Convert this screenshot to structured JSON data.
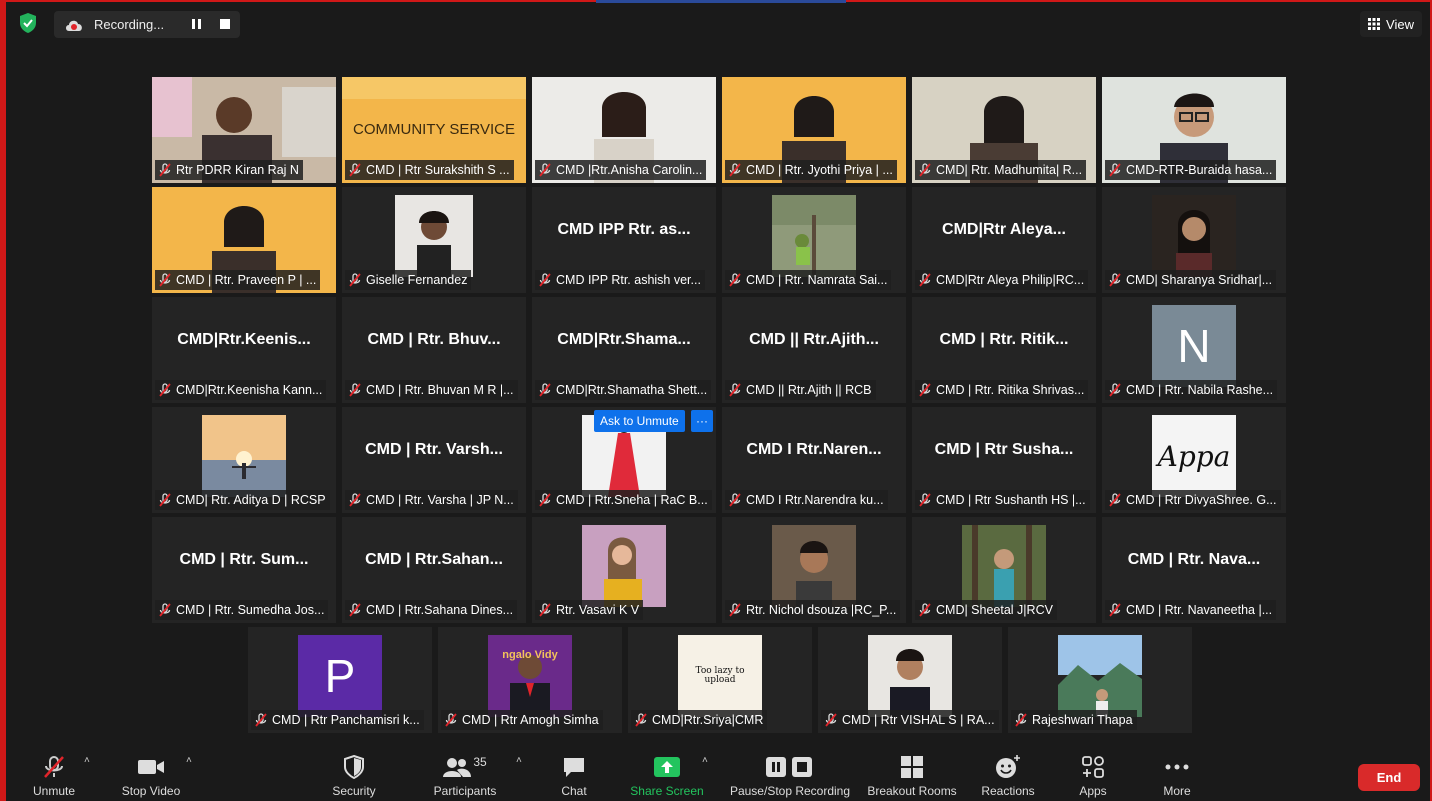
{
  "top": {
    "recording_label": "Recording...",
    "view_label": "View"
  },
  "ask_unmute": {
    "label": "Ask to Unmute",
    "more": "···"
  },
  "rows": [
    [
      {
        "label": "Rtr PDRR Kiran Raj N",
        "big": "",
        "speaking": true,
        "video": "person-indoor"
      },
      {
        "label": "CMD | Rtr Surakshith S ...",
        "big": "",
        "video": "community-banner",
        "banner": "COMMUNITY SERVICE"
      },
      {
        "label": "CMD |Rtr.Anisha Carolin...",
        "big": "",
        "video": "person-light"
      },
      {
        "label": "CMD | Rtr. Jyothi Priya | ...",
        "big": "",
        "video": "person-banner"
      },
      {
        "label": "CMD| Rtr. Madhumita| R...",
        "big": "",
        "video": "person-wall"
      },
      {
        "label": "CMD-RTR-Buraida hasa...",
        "big": "",
        "video": "person-glasses"
      }
    ],
    [
      {
        "label": "CMD | Rtr. Praveen P | ...",
        "big": "",
        "video": "person-banner"
      },
      {
        "label": "Giselle Fernandez",
        "big": "",
        "video": "thumb-portrait"
      },
      {
        "label": "CMD IPP Rtr. ashish ver...",
        "big": "CMD IPP Rtr. as..."
      },
      {
        "label": "CMD | Rtr.  Namrata Sai...",
        "big": "",
        "video": "thumb-tree"
      },
      {
        "label": "CMD|Rtr Aleya Philip|RC...",
        "big": "CMD|Rtr  Aleya..."
      },
      {
        "label": "CMD| Sharanya Sridhar|...",
        "big": "",
        "video": "thumb-dark"
      }
    ],
    [
      {
        "label": "CMD|Rtr.Keenisha Kann...",
        "big": "CMD|Rtr.Keenis..."
      },
      {
        "label": "CMD | Rtr. Bhuvan M R |...",
        "big": "CMD | Rtr. Bhuv..."
      },
      {
        "label": "CMD|Rtr.Shamatha Shett...",
        "big": "CMD|Rtr.Shama..."
      },
      {
        "label": "CMD || Rtr.Ajith || RCB",
        "big": "CMD || Rtr.Ajith..."
      },
      {
        "label": "CMD | Rtr. Ritika Shrivas...",
        "big": "CMD | Rtr. Ritik..."
      },
      {
        "label": "CMD | Rtr. Nabila Rashe...",
        "big": "",
        "video": "avatar",
        "avatar": "N",
        "avatar_color": "#7a8a96"
      }
    ],
    [
      {
        "label": "CMD| Rtr. Aditya D | RCSP",
        "big": "",
        "video": "thumb-sunset"
      },
      {
        "label": "CMD | Rtr. Varsha | JP N...",
        "big": "CMD | Rtr. Varsh..."
      },
      {
        "label": "CMD | Rtr.Sneha | RaC B...",
        "big": "",
        "video": "thumb-dress"
      },
      {
        "label": "CMD I Rtr.Narendra ku...",
        "big": "CMD I Rtr.Naren..."
      },
      {
        "label": "CMD | Rtr Sushanth HS |...",
        "big": "CMD | Rtr Susha..."
      },
      {
        "label": "CMD | Rtr DivyaShree. G...",
        "big": "",
        "video": "thumb-appa",
        "thumb_text": "Appa"
      }
    ],
    [
      {
        "label": "CMD | Rtr. Sumedha Jos...",
        "big": "CMD | Rtr. Sum..."
      },
      {
        "label": "CMD | Rtr.Sahana Dines...",
        "big": "CMD | Rtr.Sahan..."
      },
      {
        "label": "Rtr. Vasavi K V",
        "big": "",
        "video": "thumb-pink"
      },
      {
        "label": "Rtr. Nichol dsouza |RC_P...",
        "big": "",
        "video": "thumb-man"
      },
      {
        "label": "CMD| Sheetal J|RCV",
        "big": "",
        "video": "thumb-forest"
      },
      {
        "label": "CMD | Rtr. Navaneetha |...",
        "big": "CMD | Rtr. Nava..."
      }
    ],
    [
      {
        "label": "CMD | Rtr Panchamisri k...",
        "big": "",
        "video": "avatar",
        "avatar": "P",
        "avatar_color": "#5b2aa6"
      },
      {
        "label": "CMD | Rtr Amogh Simha",
        "big": "",
        "video": "thumb-suit",
        "thumb_text": "ngalo  Vidy"
      },
      {
        "label": "CMD|Rtr.Sriya|CMR",
        "big": "",
        "video": "thumb-text",
        "thumb_text": "Too lazy to upload"
      },
      {
        "label": "CMD | Rtr VISHAL S | RA...",
        "big": "",
        "video": "thumb-man2"
      },
      {
        "label": "Rajeshwari Thapa",
        "big": "",
        "video": "thumb-mountain"
      }
    ]
  ],
  "toolbar": {
    "unmute": "Unmute",
    "stop_video": "Stop Video",
    "security": "Security",
    "participants": "Participants",
    "participants_count": "35",
    "chat": "Chat",
    "share_screen": "Share Screen",
    "pause_stop_recording": "Pause/Stop Recording",
    "breakout_rooms": "Breakout Rooms",
    "reactions": "Reactions",
    "apps": "Apps",
    "more": "More",
    "end": "End"
  },
  "colors": {
    "speaking": "#a5d63b",
    "share": "#23c45e",
    "end": "#d92a2a",
    "ask": "#0e71eb"
  }
}
